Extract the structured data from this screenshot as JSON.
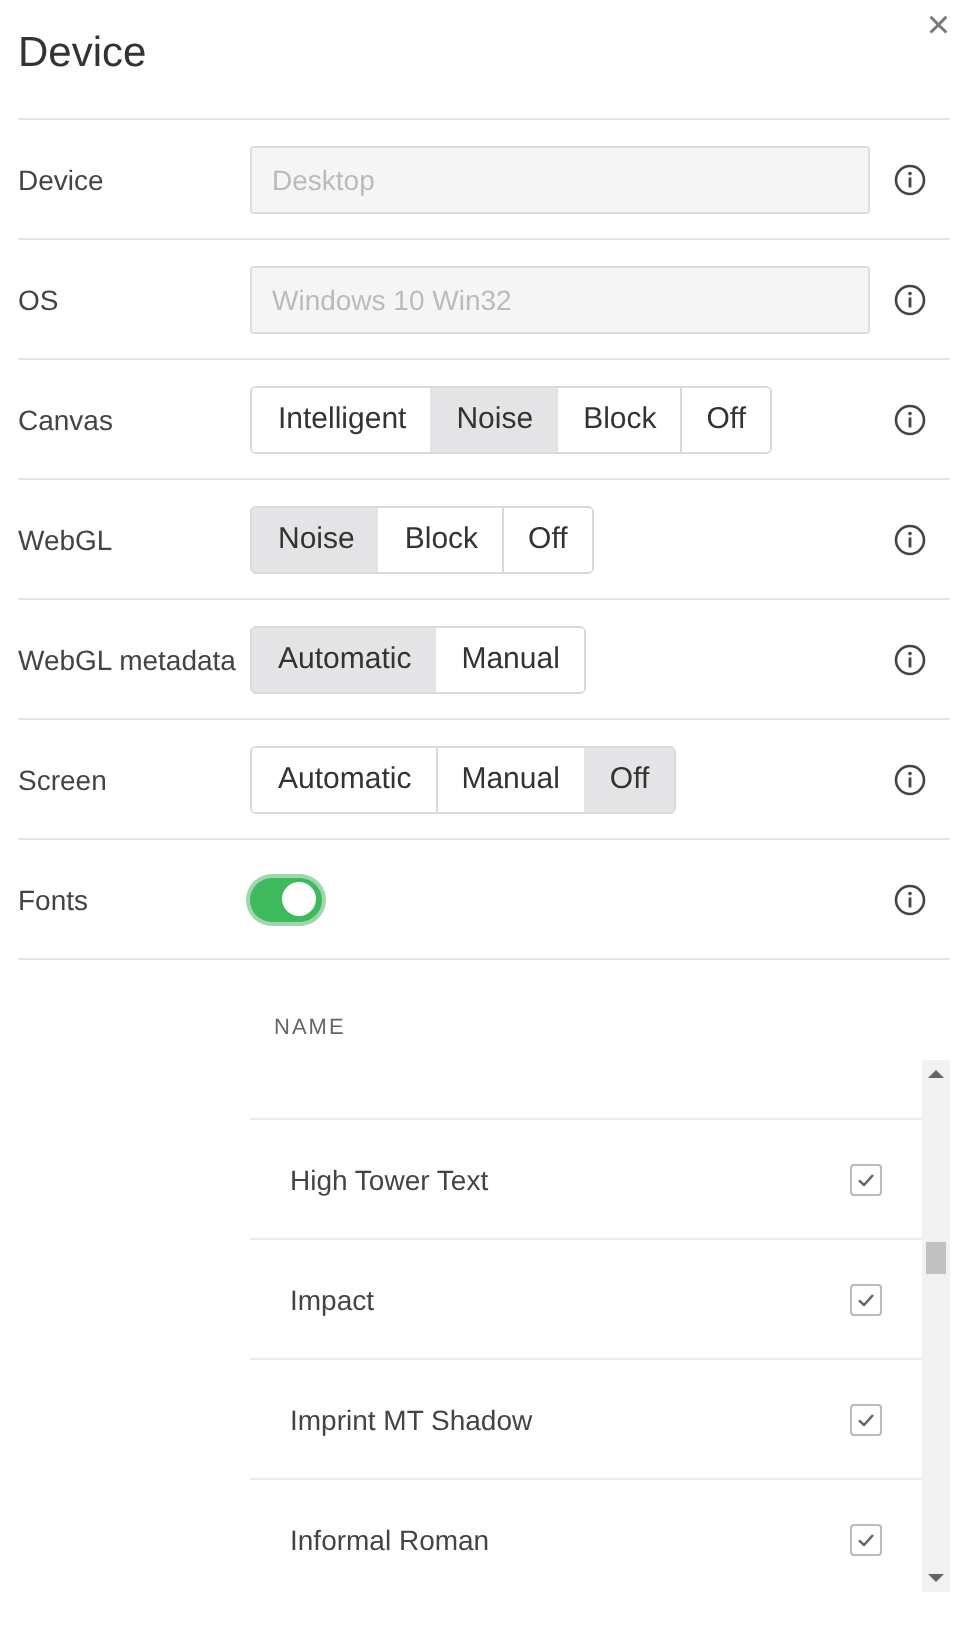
{
  "dialog": {
    "title": "Device",
    "close": "×"
  },
  "settings": [
    {
      "kind": "input",
      "label": "Device",
      "placeholder": "Desktop",
      "disabled": true
    },
    {
      "kind": "input",
      "label": "OS",
      "placeholder": "Windows 10 Win32",
      "disabled": true
    },
    {
      "kind": "segmented",
      "label": "Canvas",
      "options": [
        {
          "label": "Intelligent",
          "selected": false
        },
        {
          "label": "Noise",
          "selected": true
        },
        {
          "label": "Block",
          "selected": false
        },
        {
          "label": "Off",
          "selected": false
        }
      ]
    },
    {
      "kind": "segmented",
      "label": "WebGL",
      "options": [
        {
          "label": "Noise",
          "selected": true
        },
        {
          "label": "Block",
          "selected": false
        },
        {
          "label": "Off",
          "selected": false
        }
      ]
    },
    {
      "kind": "segmented",
      "label": "WebGL metadata",
      "options": [
        {
          "label": "Automatic",
          "selected": true
        },
        {
          "label": "Manual",
          "selected": false
        }
      ]
    },
    {
      "kind": "segmented",
      "label": "Screen",
      "options": [
        {
          "label": "Automatic",
          "selected": false
        },
        {
          "label": "Manual",
          "selected": false
        },
        {
          "label": "Off",
          "selected": true
        }
      ]
    },
    {
      "kind": "toggle",
      "label": "Fonts",
      "on": true
    }
  ],
  "fonts_table": {
    "column": "NAME",
    "rows": [
      {
        "name": "High Tower Text",
        "checked": true
      },
      {
        "name": "Impact",
        "checked": true
      },
      {
        "name": "Imprint MT Shadow",
        "checked": true
      },
      {
        "name": "Informal Roman",
        "checked": true
      }
    ]
  }
}
